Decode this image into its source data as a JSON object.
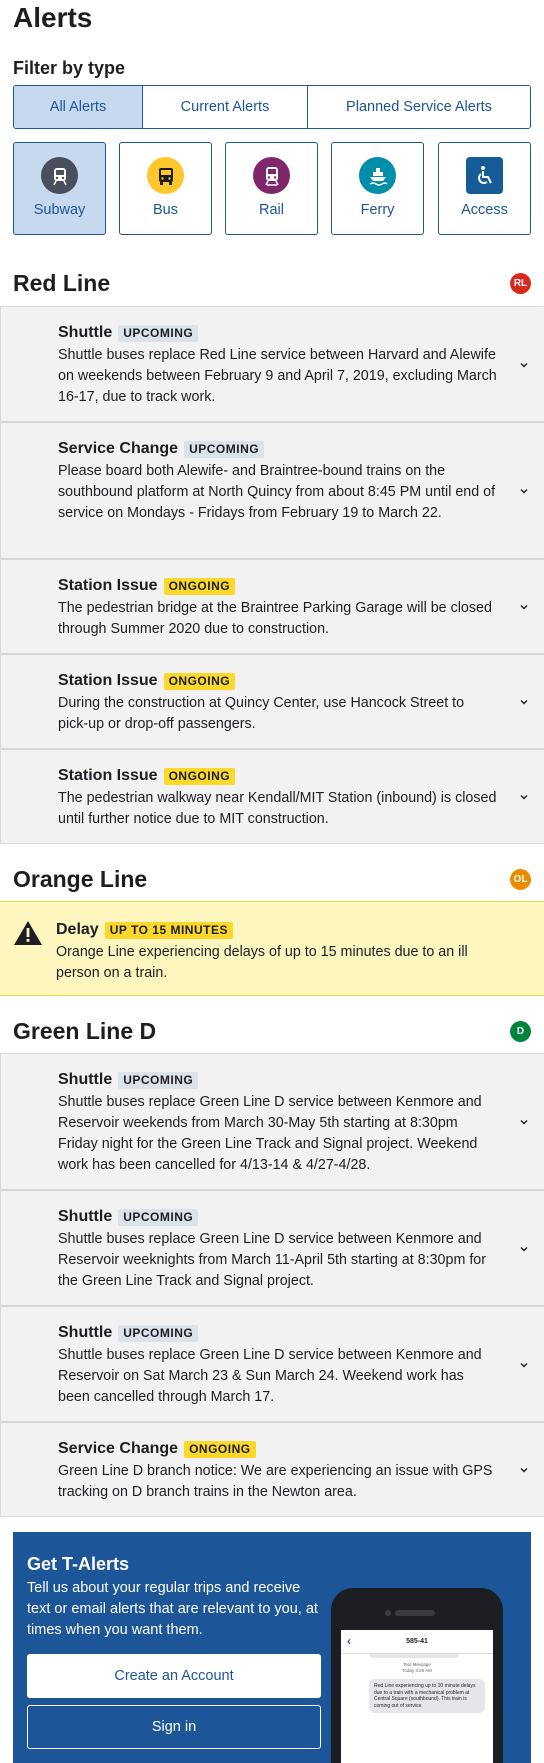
{
  "page": {
    "title": "Alerts"
  },
  "filter": {
    "label": "Filter by type",
    "tabs": [
      {
        "label": "All Alerts",
        "active": true
      },
      {
        "label": "Current Alerts",
        "active": false
      },
      {
        "label": "Planned Service Alerts",
        "active": false
      }
    ],
    "modes": [
      {
        "label": "Subway",
        "icon": "subway-icon",
        "color": "#494f5c",
        "active": true
      },
      {
        "label": "Bus",
        "icon": "bus-icon",
        "color": "#ffc72c",
        "active": false
      },
      {
        "label": "Rail",
        "icon": "commuter-rail-icon",
        "color": "#80276c",
        "active": false
      },
      {
        "label": "Ferry",
        "icon": "ferry-icon",
        "color": "#008eaa",
        "active": false
      },
      {
        "label": "Access",
        "icon": "accessibility-icon",
        "color": "#165c96",
        "active": false
      }
    ]
  },
  "lines": [
    {
      "name": "Red Line",
      "badge": "RL",
      "color": "#da291c",
      "alerts": [
        {
          "effect": "Shuttle",
          "lifecycle": "UPCOMING",
          "text": "Shuttle buses replace Red Line service between Harvard and Alewife on weekends between February 9 and April 7, 2019, excluding March 16-17, due to track work."
        },
        {
          "effect": "Service Change",
          "lifecycle": "UPCOMING",
          "text": "Please board both Alewife- and Braintree-bound trains on the southbound platform at North Quincy from about 8:45 PM until end of service on Mondays - Fridays from February 19 to March 22."
        },
        {
          "effect": "Station Issue",
          "lifecycle": "ONGOING",
          "text": "The pedestrian bridge at the Braintree Parking Garage will be closed through Summer 2020 due to construction."
        },
        {
          "effect": "Station Issue",
          "lifecycle": "ONGOING",
          "text": "During the construction at Quincy Center, use Hancock Street to pick-up or drop-off passengers."
        },
        {
          "effect": "Station Issue",
          "lifecycle": "ONGOING",
          "text": "The pedestrian walkway near Kendall/MIT Station (inbound) is closed until further notice due to MIT construction."
        }
      ]
    },
    {
      "name": "Orange Line",
      "badge": "OL",
      "color": "#ed8b00",
      "alerts": [
        {
          "effect": "Delay",
          "lifecycle": "UP TO 15 MINUTES",
          "text": "Orange Line experiencing delays of up to 15 minutes due to an ill person on a train."
        }
      ]
    },
    {
      "name": "Green Line D",
      "badge": "D",
      "color": "#00843d",
      "alerts": [
        {
          "effect": "Shuttle",
          "lifecycle": "UPCOMING",
          "text": "Shuttle buses replace Green Line D service between Kenmore and Reservoir weekends from March 30-May 5th starting at 8:30pm Friday night for the Green Line Track and Signal project. Weekend work has been cancelled for 4/13-14 & 4/27-4/28."
        },
        {
          "effect": "Shuttle",
          "lifecycle": "UPCOMING",
          "text": "Shuttle buses replace Green Line D service between Kenmore and Reservoir weeknights from March 11-April 5th starting at 8:30pm for the Green Line Track and Signal project."
        },
        {
          "effect": "Shuttle",
          "lifecycle": "UPCOMING",
          "text": "Shuttle buses replace Green Line D service between Kenmore and Reservoir on Sat March 23 & Sun March 24. Weekend work has been cancelled through March 17."
        },
        {
          "effect": "Service Change",
          "lifecycle": "ONGOING",
          "text": "Green Line D branch notice: We are experiencing an issue with GPS tracking on D branch trains in the Newton area."
        }
      ]
    }
  ],
  "talerts": {
    "title": "Get T-Alerts",
    "description": "Tell us about your regular trips and receive text or email alerts that are relevant to you, at times when you want them.",
    "create_label": "Create an Account",
    "signin_label": "Sign in",
    "phone": {
      "contact": "585-41",
      "meta_line1": "Text Message",
      "meta_line2": "Today 3:25 AM",
      "message": "Red Line experiencing up to 10 minute delays due to a train with a mechanical problem at Central Square (southbound). This train is coming out of service."
    }
  }
}
